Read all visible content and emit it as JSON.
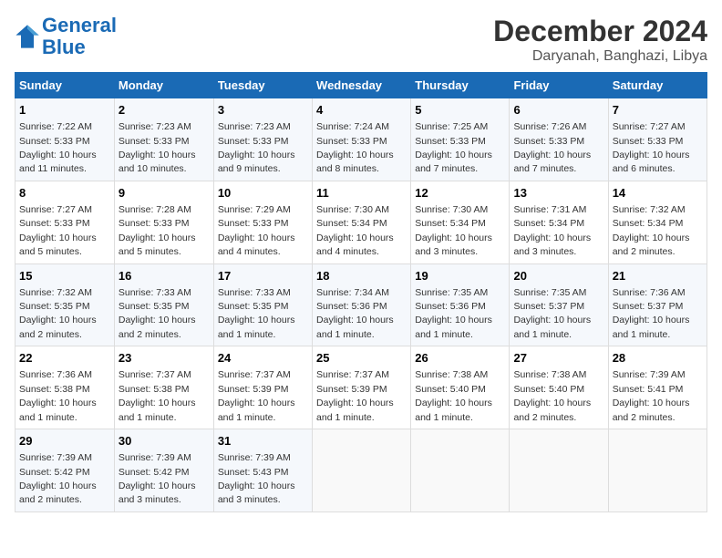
{
  "header": {
    "logo_line1": "General",
    "logo_line2": "Blue",
    "month": "December 2024",
    "location": "Daryanah, Banghazi, Libya"
  },
  "weekdays": [
    "Sunday",
    "Monday",
    "Tuesday",
    "Wednesday",
    "Thursday",
    "Friday",
    "Saturday"
  ],
  "weeks": [
    [
      {
        "day": "1",
        "sunrise": "Sunrise: 7:22 AM",
        "sunset": "Sunset: 5:33 PM",
        "daylight": "Daylight: 10 hours and 11 minutes."
      },
      {
        "day": "2",
        "sunrise": "Sunrise: 7:23 AM",
        "sunset": "Sunset: 5:33 PM",
        "daylight": "Daylight: 10 hours and 10 minutes."
      },
      {
        "day": "3",
        "sunrise": "Sunrise: 7:23 AM",
        "sunset": "Sunset: 5:33 PM",
        "daylight": "Daylight: 10 hours and 9 minutes."
      },
      {
        "day": "4",
        "sunrise": "Sunrise: 7:24 AM",
        "sunset": "Sunset: 5:33 PM",
        "daylight": "Daylight: 10 hours and 8 minutes."
      },
      {
        "day": "5",
        "sunrise": "Sunrise: 7:25 AM",
        "sunset": "Sunset: 5:33 PM",
        "daylight": "Daylight: 10 hours and 7 minutes."
      },
      {
        "day": "6",
        "sunrise": "Sunrise: 7:26 AM",
        "sunset": "Sunset: 5:33 PM",
        "daylight": "Daylight: 10 hours and 7 minutes."
      },
      {
        "day": "7",
        "sunrise": "Sunrise: 7:27 AM",
        "sunset": "Sunset: 5:33 PM",
        "daylight": "Daylight: 10 hours and 6 minutes."
      }
    ],
    [
      {
        "day": "8",
        "sunrise": "Sunrise: 7:27 AM",
        "sunset": "Sunset: 5:33 PM",
        "daylight": "Daylight: 10 hours and 5 minutes."
      },
      {
        "day": "9",
        "sunrise": "Sunrise: 7:28 AM",
        "sunset": "Sunset: 5:33 PM",
        "daylight": "Daylight: 10 hours and 5 minutes."
      },
      {
        "day": "10",
        "sunrise": "Sunrise: 7:29 AM",
        "sunset": "Sunset: 5:33 PM",
        "daylight": "Daylight: 10 hours and 4 minutes."
      },
      {
        "day": "11",
        "sunrise": "Sunrise: 7:30 AM",
        "sunset": "Sunset: 5:34 PM",
        "daylight": "Daylight: 10 hours and 4 minutes."
      },
      {
        "day": "12",
        "sunrise": "Sunrise: 7:30 AM",
        "sunset": "Sunset: 5:34 PM",
        "daylight": "Daylight: 10 hours and 3 minutes."
      },
      {
        "day": "13",
        "sunrise": "Sunrise: 7:31 AM",
        "sunset": "Sunset: 5:34 PM",
        "daylight": "Daylight: 10 hours and 3 minutes."
      },
      {
        "day": "14",
        "sunrise": "Sunrise: 7:32 AM",
        "sunset": "Sunset: 5:34 PM",
        "daylight": "Daylight: 10 hours and 2 minutes."
      }
    ],
    [
      {
        "day": "15",
        "sunrise": "Sunrise: 7:32 AM",
        "sunset": "Sunset: 5:35 PM",
        "daylight": "Daylight: 10 hours and 2 minutes."
      },
      {
        "day": "16",
        "sunrise": "Sunrise: 7:33 AM",
        "sunset": "Sunset: 5:35 PM",
        "daylight": "Daylight: 10 hours and 2 minutes."
      },
      {
        "day": "17",
        "sunrise": "Sunrise: 7:33 AM",
        "sunset": "Sunset: 5:35 PM",
        "daylight": "Daylight: 10 hours and 1 minute."
      },
      {
        "day": "18",
        "sunrise": "Sunrise: 7:34 AM",
        "sunset": "Sunset: 5:36 PM",
        "daylight": "Daylight: 10 hours and 1 minute."
      },
      {
        "day": "19",
        "sunrise": "Sunrise: 7:35 AM",
        "sunset": "Sunset: 5:36 PM",
        "daylight": "Daylight: 10 hours and 1 minute."
      },
      {
        "day": "20",
        "sunrise": "Sunrise: 7:35 AM",
        "sunset": "Sunset: 5:37 PM",
        "daylight": "Daylight: 10 hours and 1 minute."
      },
      {
        "day": "21",
        "sunrise": "Sunrise: 7:36 AM",
        "sunset": "Sunset: 5:37 PM",
        "daylight": "Daylight: 10 hours and 1 minute."
      }
    ],
    [
      {
        "day": "22",
        "sunrise": "Sunrise: 7:36 AM",
        "sunset": "Sunset: 5:38 PM",
        "daylight": "Daylight: 10 hours and 1 minute."
      },
      {
        "day": "23",
        "sunrise": "Sunrise: 7:37 AM",
        "sunset": "Sunset: 5:38 PM",
        "daylight": "Daylight: 10 hours and 1 minute."
      },
      {
        "day": "24",
        "sunrise": "Sunrise: 7:37 AM",
        "sunset": "Sunset: 5:39 PM",
        "daylight": "Daylight: 10 hours and 1 minute."
      },
      {
        "day": "25",
        "sunrise": "Sunrise: 7:37 AM",
        "sunset": "Sunset: 5:39 PM",
        "daylight": "Daylight: 10 hours and 1 minute."
      },
      {
        "day": "26",
        "sunrise": "Sunrise: 7:38 AM",
        "sunset": "Sunset: 5:40 PM",
        "daylight": "Daylight: 10 hours and 1 minute."
      },
      {
        "day": "27",
        "sunrise": "Sunrise: 7:38 AM",
        "sunset": "Sunset: 5:40 PM",
        "daylight": "Daylight: 10 hours and 2 minutes."
      },
      {
        "day": "28",
        "sunrise": "Sunrise: 7:39 AM",
        "sunset": "Sunset: 5:41 PM",
        "daylight": "Daylight: 10 hours and 2 minutes."
      }
    ],
    [
      {
        "day": "29",
        "sunrise": "Sunrise: 7:39 AM",
        "sunset": "Sunset: 5:42 PM",
        "daylight": "Daylight: 10 hours and 2 minutes."
      },
      {
        "day": "30",
        "sunrise": "Sunrise: 7:39 AM",
        "sunset": "Sunset: 5:42 PM",
        "daylight": "Daylight: 10 hours and 3 minutes."
      },
      {
        "day": "31",
        "sunrise": "Sunrise: 7:39 AM",
        "sunset": "Sunset: 5:43 PM",
        "daylight": "Daylight: 10 hours and 3 minutes."
      },
      null,
      null,
      null,
      null
    ]
  ]
}
